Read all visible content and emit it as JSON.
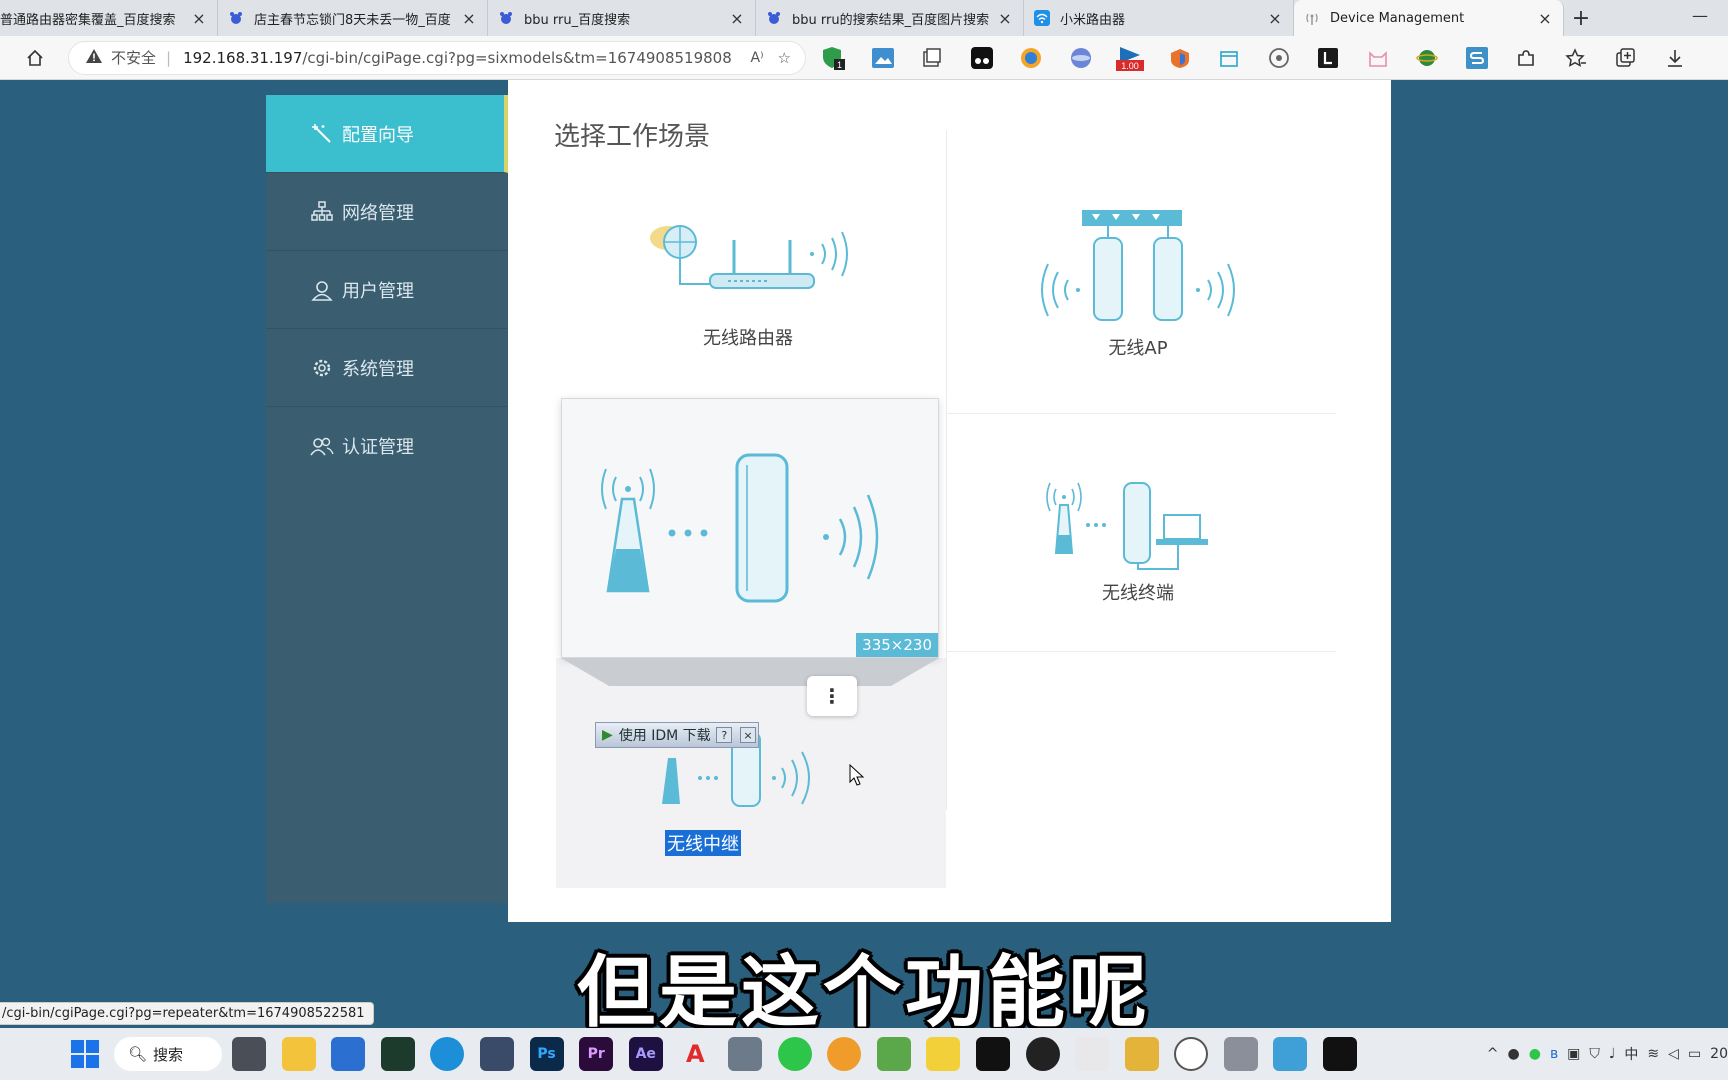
{
  "browser": {
    "tabs": [
      {
        "title": "普通路由器密集覆盖_百度搜索",
        "icon": "baidu-icon"
      },
      {
        "title": "店主春节忘锁门8天未丢一物_百度",
        "icon": "baidu-icon"
      },
      {
        "title": "bbu rru_百度搜索",
        "icon": "baidu-icon"
      },
      {
        "title": "bbu rru的搜索结果_百度图片搜索",
        "icon": "baidu-icon"
      },
      {
        "title": "小米路由器",
        "icon": "wifi-icon"
      },
      {
        "title": "Device Management",
        "icon": "antenna-icon",
        "active": true
      }
    ],
    "new_tab": "+",
    "minimize": "—",
    "address": {
      "security_label": "不安全",
      "host": "192.168.31.197",
      "path": "/cgi-bin/cgiPage.cgi?pg=sixmodels&tm=1674908519808",
      "read_aloud": "A⁾"
    },
    "extension_badges": {
      "shield": "1",
      "speed": "1.00"
    },
    "status_url": "/cgi-bin/cgiPage.cgi?pg=repeater&tm=1674908522581"
  },
  "sidebar": {
    "items": [
      {
        "label": "配置向导",
        "icon": "magic-wand-icon",
        "active": true
      },
      {
        "label": "网络管理",
        "icon": "network-icon"
      },
      {
        "label": "用户管理",
        "icon": "user-icon"
      },
      {
        "label": "系统管理",
        "icon": "gear-icon"
      },
      {
        "label": "认证管理",
        "icon": "users-icon"
      }
    ]
  },
  "content": {
    "title": "选择工作场景",
    "modes": {
      "router": "无线路由器",
      "ap": "无线AP",
      "terminal": "无线终端",
      "repeater": "无线中继"
    },
    "preview_size": "335×230",
    "more": "⋮",
    "idm_label": "使用 IDM 下载",
    "idm_help": "?",
    "idm_close": "×"
  },
  "subtitle": "但是这个功能呢",
  "taskbar": {
    "search_label": "搜索",
    "apps": [
      "Ps",
      "Pr",
      "Ae",
      "A"
    ],
    "clock_fragment": "20"
  },
  "colors": {
    "sidebar_bg": "#3a5d6f",
    "active_item": "#3bbfcf",
    "page_bg": "#2a5f7d",
    "illustration_blue": "#5bbad6"
  }
}
